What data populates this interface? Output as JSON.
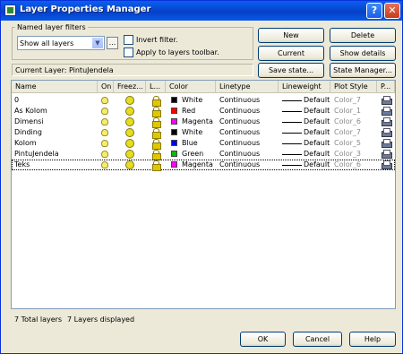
{
  "window": {
    "title": "Layer Properties Manager",
    "help_glyph": "?",
    "close_glyph": "✕"
  },
  "filters": {
    "legend": "Named layer filters",
    "combo_value": "Show all layers",
    "dots_label": "...",
    "invert_label": "Invert filter.",
    "apply_label": "Apply to layers toolbar."
  },
  "buttons": {
    "new": "New",
    "delete": "Delete",
    "current": "Current",
    "show_details": "Show details",
    "save_state": "Save state...",
    "state_manager": "State Manager...",
    "ok": "OK",
    "cancel": "Cancel",
    "help": "Help"
  },
  "current_layer": "Current Layer:  PintuJendela",
  "columns": [
    "Name",
    "On",
    "Freez...",
    "L...",
    "Color",
    "Linetype",
    "Lineweight",
    "Plot Style",
    "P..."
  ],
  "layers": [
    {
      "name": "0",
      "color_hex": "#000000",
      "color_name": "White",
      "linetype": "Continuous",
      "lineweight": "Default",
      "plot_style": "Color_7"
    },
    {
      "name": "As Kolom",
      "color_hex": "#ff0000",
      "color_name": "Red",
      "linetype": "Continuous",
      "lineweight": "Default",
      "plot_style": "Color_1"
    },
    {
      "name": "Dimensi",
      "color_hex": "#ff00ff",
      "color_name": "Magenta",
      "linetype": "Continuous",
      "lineweight": "Default",
      "plot_style": "Color_6"
    },
    {
      "name": "Dinding",
      "color_hex": "#000000",
      "color_name": "White",
      "linetype": "Continuous",
      "lineweight": "Default",
      "plot_style": "Color_7"
    },
    {
      "name": "Kolom",
      "color_hex": "#0000ff",
      "color_name": "Blue",
      "linetype": "Continuous",
      "lineweight": "Default",
      "plot_style": "Color_5"
    },
    {
      "name": "PintuJendela",
      "color_hex": "#00c000",
      "color_name": "Green",
      "linetype": "Continuous",
      "lineweight": "Default",
      "plot_style": "Color_3"
    },
    {
      "name": "Teks",
      "color_hex": "#ff00ff",
      "color_name": "Magenta",
      "linetype": "Continuous",
      "lineweight": "Default",
      "plot_style": "Color_6"
    }
  ],
  "status": {
    "total": "7 Total layers",
    "displayed": "7 Layers displayed"
  },
  "colors": {
    "titlebar": "#0846d0",
    "face": "#ece9d8"
  }
}
